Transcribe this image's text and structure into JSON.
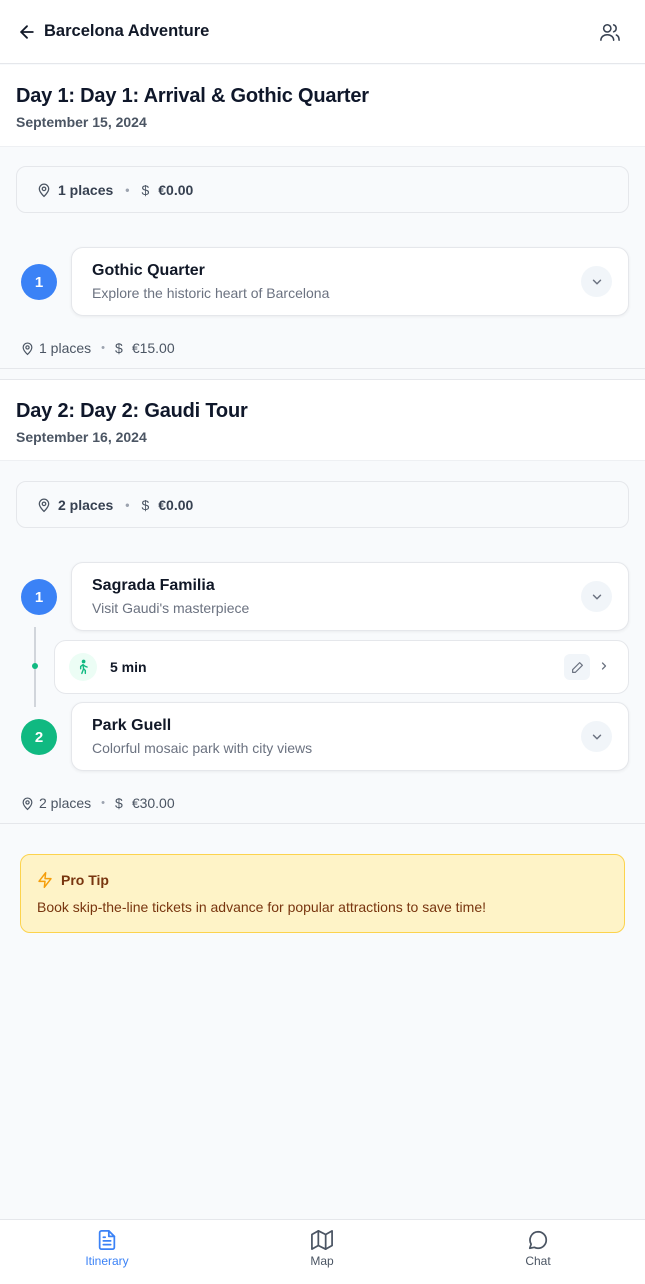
{
  "header": {
    "title": "Barcelona Adventure"
  },
  "days": [
    {
      "title": "Day 1: Day 1: Arrival & Gothic Quarter",
      "date": "September 15, 2024",
      "summary": {
        "places": "1 places",
        "cost": "€0.00"
      },
      "places": [
        {
          "number": "1",
          "name": "Gothic Quarter",
          "description": "Explore the historic heart of Barcelona"
        }
      ],
      "footer": {
        "places": "1 places",
        "cost": "€15.00"
      }
    },
    {
      "title": "Day 2: Day 2: Gaudi Tour",
      "date": "September 16, 2024",
      "summary": {
        "places": "2 places",
        "cost": "€0.00"
      },
      "places": [
        {
          "number": "1",
          "name": "Sagrada Familia",
          "description": "Visit Gaudi's masterpiece"
        },
        {
          "number": "2",
          "name": "Park Guell",
          "description": "Colorful mosaic park with city views"
        }
      ],
      "transit": {
        "mode": "walk-icon",
        "duration": "5 min"
      },
      "footer": {
        "places": "2 places",
        "cost": "€30.00"
      }
    }
  ],
  "tip": {
    "title": "Pro Tip",
    "text": "Book skip-the-line tickets in advance for popular attractions to save time!"
  },
  "tabs": [
    {
      "label": "Itinerary",
      "icon": "document-icon",
      "active": true
    },
    {
      "label": "Map",
      "icon": "map-icon",
      "active": false
    },
    {
      "label": "Chat",
      "icon": "chat-icon",
      "active": false
    }
  ],
  "colors": {
    "accent": "#3b82f6",
    "green": "#10b981",
    "tip_bg": "#fef3c7"
  }
}
